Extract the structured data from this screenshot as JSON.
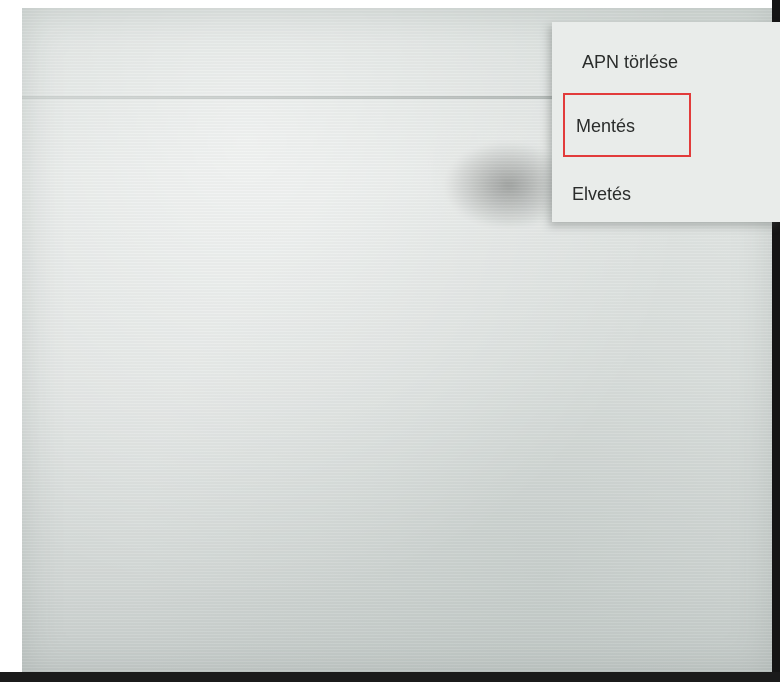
{
  "overflow_menu": {
    "items": [
      {
        "label": "APN törlése"
      },
      {
        "label": "Mentés"
      },
      {
        "label": "Elvetés"
      }
    ],
    "highlighted_index": 1
  },
  "colors": {
    "highlight_border": "#e23b3b",
    "menu_background": "#e9ecea",
    "screen_background": "#dfe3e1"
  }
}
